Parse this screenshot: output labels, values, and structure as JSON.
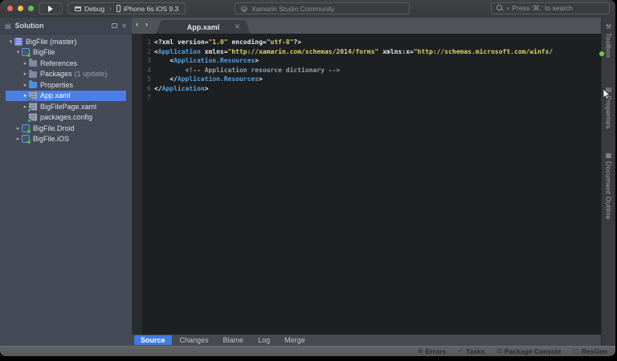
{
  "colors": {
    "selection": "#4a80e2",
    "active_tab": "#3e7ce0",
    "tag": "#53a1e0",
    "string": "#ddd169",
    "comment": "#9aa1a1",
    "plain": "#e8eae8",
    "status_ok": "#6bd43a"
  },
  "toolbar": {
    "run_icon": "run-play-icon",
    "config_label": "Debug",
    "config_separator": "›",
    "device_label": "iPhone 6s iOS 9.3",
    "status_text": "Xamarin Studio Community",
    "status_icon": "xamarin-logo-icon",
    "search_placeholder": "Press '⌘.' to search",
    "search_caret": "▾"
  },
  "sidebar": {
    "title": "Solution",
    "header_icons": [
      "pad-list-icon",
      "dock-icon",
      "close-icon"
    ],
    "close_glyph": "✕",
    "tree": [
      {
        "label": "BigFile (master)",
        "indent": 0,
        "arrow": "down",
        "icon": "solution"
      },
      {
        "label": "BigFile",
        "indent": 1,
        "arrow": "down",
        "icon": "project"
      },
      {
        "label": "References",
        "indent": 2,
        "arrow": "right",
        "icon": "references-folder"
      },
      {
        "label": "Packages",
        "badge": "(1 update)",
        "indent": 2,
        "arrow": "right",
        "icon": "packages-folder"
      },
      {
        "label": "Properties",
        "indent": 2,
        "arrow": "right",
        "icon": "folder"
      },
      {
        "label": "App.xaml",
        "indent": 2,
        "arrow": "right",
        "icon": "xaml-file",
        "selected": true
      },
      {
        "label": "BigFilePage.xaml",
        "indent": 2,
        "arrow": "right",
        "icon": "xaml-file"
      },
      {
        "label": "packages.config",
        "indent": 2,
        "arrow": null,
        "icon": "config-file"
      },
      {
        "label": "BigFile.Droid",
        "indent": 1,
        "arrow": "right",
        "icon": "project"
      },
      {
        "label": "BigFile.iOS",
        "indent": 1,
        "arrow": "right",
        "icon": "project"
      }
    ]
  },
  "editor": {
    "nav_back": "‹",
    "nav_forward": "›",
    "tab_title": "App.xaml",
    "tab_close": "✕",
    "code": {
      "lines": [
        [
          {
            "t": "<?xml version=",
            "c": "pl"
          },
          {
            "t": "\"1.0\"",
            "c": "str"
          },
          {
            "t": " encoding=",
            "c": "pl"
          },
          {
            "t": "\"utf-8\"",
            "c": "str"
          },
          {
            "t": "?>",
            "c": "pl"
          }
        ],
        [
          {
            "t": "<",
            "c": "pl"
          },
          {
            "t": "Application",
            "c": "tag"
          },
          {
            "t": " xmlns=",
            "c": "pl"
          },
          {
            "t": "\"http://xamarin.com/schemas/2014/forms\"",
            "c": "str"
          },
          {
            "t": " xmlns:x=",
            "c": "pl"
          },
          {
            "t": "\"http://schemas.microsoft.com/winfx/",
            "c": "str"
          }
        ],
        [
          {
            "t": "    <",
            "c": "pl"
          },
          {
            "t": "Application.Resources",
            "c": "tag"
          },
          {
            "t": ">",
            "c": "pl"
          }
        ],
        [
          {
            "t": "        ",
            "c": "pl"
          },
          {
            "t": "<!-- Application resource dictionary -->",
            "c": "com"
          }
        ],
        [
          {
            "t": "    </",
            "c": "pl"
          },
          {
            "t": "Application.Resources",
            "c": "tag"
          },
          {
            "t": ">",
            "c": "pl"
          }
        ],
        [
          {
            "t": "</",
            "c": "pl"
          },
          {
            "t": "Application",
            "c": "tag"
          },
          {
            "t": ">",
            "c": "pl"
          }
        ],
        []
      ]
    },
    "bottom_tabs": {
      "items": [
        "Source",
        "Changes",
        "Blame",
        "Log",
        "Merge"
      ],
      "active": 0
    }
  },
  "right_panel": {
    "tabs": [
      {
        "label": "Toolbox",
        "icon": "toolbox-icon",
        "glyph": "⚒"
      },
      {
        "label": "Properties",
        "icon": "properties-icon",
        "glyph": "▤"
      },
      {
        "label": "Document Outline",
        "icon": "document-outline-icon",
        "glyph": "▦"
      }
    ]
  },
  "statusbar": {
    "items": [
      {
        "label": "Errors",
        "icon": "errors-icon",
        "glyph": "⊗"
      },
      {
        "label": "Tasks",
        "icon": "tasks-icon",
        "glyph": "✓"
      },
      {
        "label": "Package Console",
        "icon": "package-console-icon",
        "glyph": "⊡"
      },
      {
        "label": "ResGen",
        "icon": "resgen-icon",
        "glyph": "▢"
      }
    ]
  }
}
